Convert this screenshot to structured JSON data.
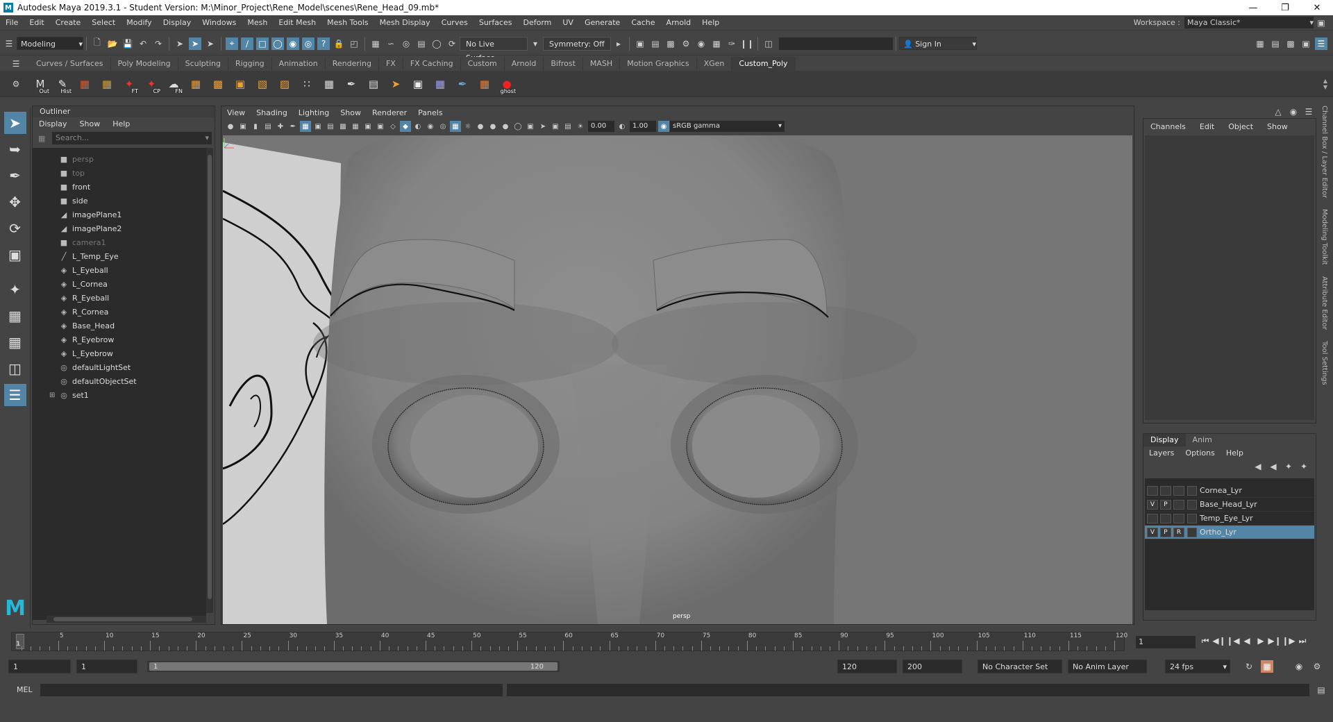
{
  "window": {
    "title": "Autodesk Maya 2019.3.1 - Student Version: M:\\Minor_Project\\Rene_Model\\scenes\\Rene_Head_09.mb*",
    "logo": "M"
  },
  "menubar": {
    "items": [
      "File",
      "Edit",
      "Create",
      "Select",
      "Modify",
      "Display",
      "Windows",
      "Mesh",
      "Edit Mesh",
      "Mesh Tools",
      "Mesh Display",
      "Curves",
      "Surfaces",
      "Deform",
      "UV",
      "Generate",
      "Cache",
      "Arnold",
      "Help"
    ],
    "workspace_label": "Workspace :",
    "workspace_value": "Maya Classic*"
  },
  "statusline": {
    "mode": "Modeling",
    "live_surface": "No Live Surface",
    "symmetry": "Symmetry: Off",
    "sign_in": "Sign In"
  },
  "shelf": {
    "tabs": [
      "Curves / Surfaces",
      "Poly Modeling",
      "Sculpting",
      "Rigging",
      "Animation",
      "Rendering",
      "FX",
      "FX Caching",
      "Custom",
      "Arnold",
      "Bifrost",
      "MASH",
      "Motion Graphics",
      "XGen",
      "Custom_Poly"
    ],
    "active_tab": "Custom_Poly",
    "icon_labels": {
      "out": "Out",
      "hist": "Hist",
      "ft": "FT",
      "cp": "CP",
      "fn": "FN",
      "ghost": "ghost"
    }
  },
  "outliner": {
    "title": "Outliner",
    "menu": [
      "Display",
      "Show",
      "Help"
    ],
    "search_placeholder": "Search...",
    "items": [
      {
        "label": "persp",
        "icon": "camera-icon",
        "dim": true
      },
      {
        "label": "top",
        "icon": "camera-icon",
        "dim": true
      },
      {
        "label": "front",
        "icon": "camera-icon",
        "dim": false
      },
      {
        "label": "side",
        "icon": "camera-icon",
        "dim": false
      },
      {
        "label": "imagePlane1",
        "icon": "image-plane-icon",
        "dim": false
      },
      {
        "label": "imagePlane2",
        "icon": "image-plane-icon",
        "dim": false
      },
      {
        "label": "camera1",
        "icon": "camera-icon",
        "dim": true
      },
      {
        "label": "L_Temp_Eye",
        "icon": "curve-icon",
        "dim": false
      },
      {
        "label": "L_Eyeball",
        "icon": "mesh-icon",
        "dim": false
      },
      {
        "label": "L_Cornea",
        "icon": "mesh-icon",
        "dim": false
      },
      {
        "label": "R_Eyeball",
        "icon": "mesh-icon",
        "dim": false
      },
      {
        "label": "R_Cornea",
        "icon": "mesh-icon",
        "dim": false
      },
      {
        "label": "Base_Head",
        "icon": "mesh-icon",
        "dim": false
      },
      {
        "label": "R_Eyebrow",
        "icon": "mesh-icon",
        "dim": false
      },
      {
        "label": "L_Eyebrow",
        "icon": "mesh-icon",
        "dim": false
      },
      {
        "label": "defaultLightSet",
        "icon": "set-icon",
        "dim": false
      },
      {
        "label": "defaultObjectSet",
        "icon": "set-icon",
        "dim": false
      },
      {
        "label": "set1",
        "icon": "set-icon",
        "dim": false,
        "expandable": true
      }
    ]
  },
  "viewport": {
    "menu": [
      "View",
      "Shading",
      "Lighting",
      "Show",
      "Renderer",
      "Panels"
    ],
    "exposure": "0.00",
    "gamma_value": "1.00",
    "color_space": "sRGB gamma",
    "camera_label": "persp"
  },
  "channelbox": {
    "menu": [
      "Channels",
      "Edit",
      "Object",
      "Show"
    ]
  },
  "layer_editor": {
    "tabs": [
      "Display",
      "Anim"
    ],
    "active_tab": "Display",
    "menu": [
      "Layers",
      "Options",
      "Help"
    ],
    "layers": [
      {
        "name": "Cornea_Lyr",
        "v": "",
        "p": "",
        "r": "",
        "selected": false
      },
      {
        "name": "Base_Head_Lyr",
        "v": "V",
        "p": "P",
        "r": "",
        "selected": false
      },
      {
        "name": "Temp_Eye_Lyr",
        "v": "",
        "p": "",
        "r": "",
        "selected": false
      },
      {
        "name": "Ortho_Lyr",
        "v": "V",
        "p": "P",
        "r": "R",
        "selected": true
      }
    ]
  },
  "side_tabs": [
    "Channel Box / Layer Editor",
    "Modeling Toolkit",
    "Attribute Editor",
    "Tool Settings"
  ],
  "timeline": {
    "ticks": [
      "5",
      "10",
      "15",
      "20",
      "25",
      "30",
      "35",
      "40",
      "45",
      "50",
      "55",
      "60",
      "65",
      "70",
      "75",
      "80",
      "85",
      "90",
      "95",
      "100",
      "105",
      "110",
      "115",
      "120"
    ],
    "start_tick": "1",
    "current_frame": "1"
  },
  "range": {
    "start": "1",
    "playback_start": "1",
    "range_start_label": "1",
    "range_end_label": "120",
    "playback_end": "120",
    "end": "200",
    "character_set": "No Character Set",
    "anim_layer": "No Anim Layer",
    "fps": "24 fps"
  },
  "command_line": {
    "label": "MEL"
  },
  "colors": {
    "accent": "#5285a6",
    "maya_logo": "#25b8d9"
  }
}
